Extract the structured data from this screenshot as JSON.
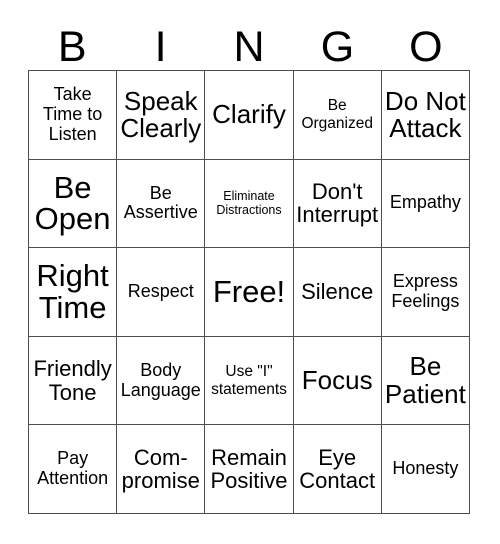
{
  "card": {
    "title": "BINGO",
    "header_letters": [
      "B",
      "I",
      "N",
      "G",
      "O"
    ],
    "columns": 5,
    "rows": 5,
    "free_space_label": "Free!",
    "free_space_position": {
      "row": 3,
      "column": 3
    },
    "colors": {
      "background": "#ffffff",
      "text": "#000000",
      "grid_line": "#4d4d4d"
    },
    "cells": [
      {
        "text": "Take\nTime to\nListen",
        "size": "md",
        "row": 1,
        "column": 1
      },
      {
        "text": "Speak\nClearly",
        "size": "xl",
        "row": 1,
        "column": 2
      },
      {
        "text": "Clarify",
        "size": "xl",
        "row": 1,
        "column": 3
      },
      {
        "text": "Be\nOrganized",
        "size": "sm",
        "row": 1,
        "column": 4
      },
      {
        "text": "Do Not\nAttack",
        "size": "xl",
        "row": 1,
        "column": 5
      },
      {
        "text": "Be\nOpen",
        "size": "xxl",
        "row": 2,
        "column": 1
      },
      {
        "text": "Be\nAssertive",
        "size": "md",
        "row": 2,
        "column": 2
      },
      {
        "text": "Eliminate\nDistractions",
        "size": "xs",
        "row": 2,
        "column": 3
      },
      {
        "text": "Don't\nInterrupt",
        "size": "lg",
        "row": 2,
        "column": 4
      },
      {
        "text": "Empathy",
        "size": "md",
        "row": 2,
        "column": 5
      },
      {
        "text": "Right\nTime",
        "size": "xxl",
        "row": 3,
        "column": 1
      },
      {
        "text": "Respect",
        "size": "md",
        "row": 3,
        "column": 2
      },
      {
        "text": "Free!",
        "size": "xxl",
        "row": 3,
        "column": 3
      },
      {
        "text": "Silence",
        "size": "lg",
        "row": 3,
        "column": 4
      },
      {
        "text": "Express\nFeelings",
        "size": "md",
        "row": 3,
        "column": 5
      },
      {
        "text": "Friendly\nTone",
        "size": "lg",
        "row": 4,
        "column": 1
      },
      {
        "text": "Body\nLanguage",
        "size": "md",
        "row": 4,
        "column": 2
      },
      {
        "text": "Use \"I\"\nstatements",
        "size": "sm",
        "row": 4,
        "column": 3
      },
      {
        "text": "Focus",
        "size": "xl",
        "row": 4,
        "column": 4
      },
      {
        "text": "Be\nPatient",
        "size": "xl",
        "row": 4,
        "column": 5
      },
      {
        "text": "Pay\nAttention",
        "size": "md",
        "row": 5,
        "column": 1
      },
      {
        "text": "Com-\npromise",
        "size": "lg",
        "row": 5,
        "column": 2
      },
      {
        "text": "Remain\nPositive",
        "size": "lg",
        "row": 5,
        "column": 3
      },
      {
        "text": "Eye\nContact",
        "size": "lg",
        "row": 5,
        "column": 4
      },
      {
        "text": "Honesty",
        "size": "md",
        "row": 5,
        "column": 5
      }
    ]
  }
}
